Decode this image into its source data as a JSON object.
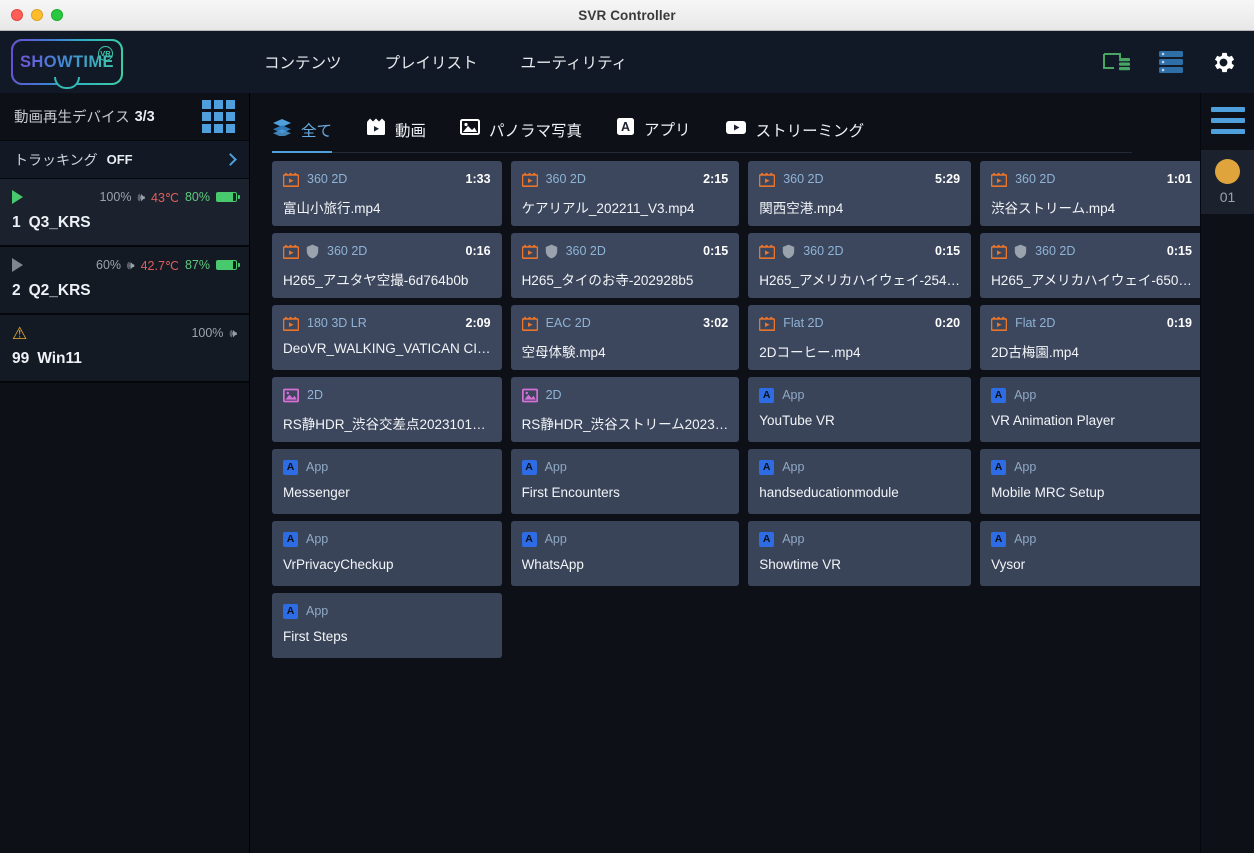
{
  "window": {
    "title": "SVR Controller"
  },
  "topnav": {
    "logo": {
      "text": "SHOWTIME",
      "badge": "VR"
    },
    "menus": [
      {
        "label": "コンテンツ",
        "name": "menu-contents"
      },
      {
        "label": "プレイリスト",
        "name": "menu-playlist"
      },
      {
        "label": "ユーティリティ",
        "name": "menu-utility"
      }
    ],
    "icons": [
      {
        "name": "cast-connection-icon",
        "color": "#49a564"
      },
      {
        "name": "server-storage-icon",
        "color": "#2f6fa8"
      },
      {
        "name": "gear-icon",
        "color": "#ffffff"
      }
    ]
  },
  "sidebar": {
    "header": {
      "label": "動画再生デバイス",
      "count": "3/3",
      "grid_icon": "grid-view-icon"
    },
    "tracking": {
      "label": "トラッキング",
      "state": "OFF",
      "chevron": "chevron-right-icon"
    },
    "devices": [
      {
        "index": "1",
        "name": "Q3_KRS",
        "status_icon": "play-icon",
        "state": "playing",
        "volume": "100%",
        "speaker_icon": "speaker-icon",
        "temperature": "43℃",
        "battery": "80%",
        "selected": true
      },
      {
        "index": "2",
        "name": "Q2_KRS",
        "status_icon": "play-icon",
        "state": "idle",
        "volume": "60%",
        "speaker_icon": "speaker-icon",
        "temperature": "42.7℃",
        "battery": "87%",
        "selected": false
      },
      {
        "index": "99",
        "name": "Win11",
        "status_icon": "warning-icon",
        "state": "warning",
        "volume": "100%",
        "speaker_icon": "speaker-icon",
        "temperature": "",
        "battery": "",
        "selected": false
      }
    ]
  },
  "tabs": [
    {
      "label": "全て",
      "icon": "layers-icon",
      "active": true,
      "name": "tab-all"
    },
    {
      "label": "動画",
      "icon": "film-icon",
      "active": false,
      "name": "tab-video"
    },
    {
      "label": "パノラマ写真",
      "icon": "photo-icon",
      "active": false,
      "name": "tab-panorama"
    },
    {
      "label": "アプリ",
      "icon": "app-icon",
      "active": false,
      "name": "tab-app"
    },
    {
      "label": "ストリーミング",
      "icon": "stream-icon",
      "active": false,
      "name": "tab-streaming"
    }
  ],
  "cards": [
    {
      "kind": "video",
      "type": "360 2D",
      "duration": "1:33",
      "name": "富山小旅行.mp4",
      "drm": false
    },
    {
      "kind": "video",
      "type": "360 2D",
      "duration": "2:15",
      "name": "ケアリアル_202211_V3.mp4",
      "drm": false
    },
    {
      "kind": "video",
      "type": "360 2D",
      "duration": "5:29",
      "name": "関西空港.mp4",
      "drm": false
    },
    {
      "kind": "video",
      "type": "360 2D",
      "duration": "1:01",
      "name": "渋谷ストリーム.mp4",
      "drm": false
    },
    {
      "kind": "video",
      "type": "360 2D",
      "duration": "0:16",
      "name": "H265_アユタヤ空撮-6d764b0b",
      "drm": true
    },
    {
      "kind": "video",
      "type": "360 2D",
      "duration": "0:15",
      "name": "H265_タイのお寺-202928b5",
      "drm": true
    },
    {
      "kind": "video",
      "type": "360 2D",
      "duration": "0:15",
      "name": "H265_アメリカハイウェイ-254…",
      "drm": true
    },
    {
      "kind": "video",
      "type": "360 2D",
      "duration": "0:15",
      "name": "H265_アメリカハイウェイ-650…",
      "drm": true
    },
    {
      "kind": "video",
      "type": "180 3D LR",
      "duration": "2:09",
      "name": "DeoVR_WALKING_VATICAN CI…",
      "drm": false
    },
    {
      "kind": "video",
      "type": "EAC 2D",
      "duration": "3:02",
      "name": "空母体験.mp4",
      "drm": false
    },
    {
      "kind": "video",
      "type": "Flat 2D",
      "duration": "0:20",
      "name": "2Dコーヒー.mp4",
      "drm": false
    },
    {
      "kind": "video",
      "type": "Flat 2D",
      "duration": "0:19",
      "name": "2D古梅園.mp4",
      "drm": false
    },
    {
      "kind": "photo",
      "type": "2D",
      "duration": "",
      "name": "RS静HDR_渋谷交差点2023101…",
      "drm": false
    },
    {
      "kind": "photo",
      "type": "2D",
      "duration": "",
      "name": "RS静HDR_渋谷ストリーム2023…",
      "drm": false
    },
    {
      "kind": "app",
      "type": "App",
      "duration": "",
      "name": "YouTube VR",
      "drm": false
    },
    {
      "kind": "app",
      "type": "App",
      "duration": "",
      "name": "VR Animation Player",
      "drm": false
    },
    {
      "kind": "app",
      "type": "App",
      "duration": "",
      "name": "Messenger",
      "drm": false
    },
    {
      "kind": "app",
      "type": "App",
      "duration": "",
      "name": "First Encounters",
      "drm": false
    },
    {
      "kind": "app",
      "type": "App",
      "duration": "",
      "name": "handseducationmodule",
      "drm": false
    },
    {
      "kind": "app",
      "type": "App",
      "duration": "",
      "name": "Mobile MRC Setup",
      "drm": false
    },
    {
      "kind": "app",
      "type": "App",
      "duration": "",
      "name": "VrPrivacyCheckup",
      "drm": false
    },
    {
      "kind": "app",
      "type": "App",
      "duration": "",
      "name": "WhatsApp",
      "drm": false
    },
    {
      "kind": "app",
      "type": "App",
      "duration": "",
      "name": "Showtime VR",
      "drm": false
    },
    {
      "kind": "app",
      "type": "App",
      "duration": "",
      "name": "Vysor",
      "drm": false
    },
    {
      "kind": "app",
      "type": "App",
      "duration": "",
      "name": "First Steps",
      "drm": false
    }
  ],
  "rightrail": {
    "menu_icon": "hamburger-menu-icon",
    "slot": {
      "dot_color": "#e0a43c",
      "label": "01"
    }
  },
  "colors": {
    "accent_blue": "#4f9fdd",
    "card_bg": "#3c465c",
    "video_icon": "#e8752b",
    "photo_icon": "#d66fd6",
    "app_icon": "#2d6ce4",
    "battery_green": "#49c96d",
    "temp_red": "#e05c5c",
    "warning_amber": "#e8ab33"
  }
}
